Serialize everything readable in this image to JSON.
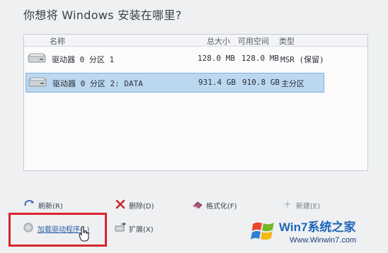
{
  "dialog": {
    "title": "你想将 Windows 安装在哪里?"
  },
  "table": {
    "columns": {
      "name": "名称",
      "total": "总大小",
      "free": "可用空间",
      "type": "类型"
    },
    "rows": [
      {
        "name": "驱动器 0 分区 1",
        "total": "128.0 MB",
        "free": "128.0 MB",
        "type": "MSR (保留)",
        "selected": false
      },
      {
        "name": "驱动器 0 分区 2: DATA",
        "total": "931.4 GB",
        "free": "910.8 GB",
        "type": "主分区",
        "selected": true
      }
    ]
  },
  "actions": {
    "refresh": "刷新(R)",
    "delete": "删除(D)",
    "format": "格式化(F)",
    "new": "新建(E)",
    "load_driver": "加载驱动程序(L)",
    "extend": "扩展(X)"
  },
  "icons": {
    "refresh": "refresh-icon",
    "delete": "red-x-icon",
    "format": "eraser-icon",
    "new": "sparkle-icon",
    "load_driver": "disc-icon",
    "extend": "extend-drive-icon",
    "cursor": "hand-pointer-icon",
    "drive": "hard-drive-icon"
  },
  "colors": {
    "selected_row": "#bcd8f0",
    "highlight_box": "#d8242b",
    "link": "#2d5fa8"
  },
  "watermark": {
    "brand": "Win7系统之家",
    "url": "Www.Winwin7.com"
  }
}
